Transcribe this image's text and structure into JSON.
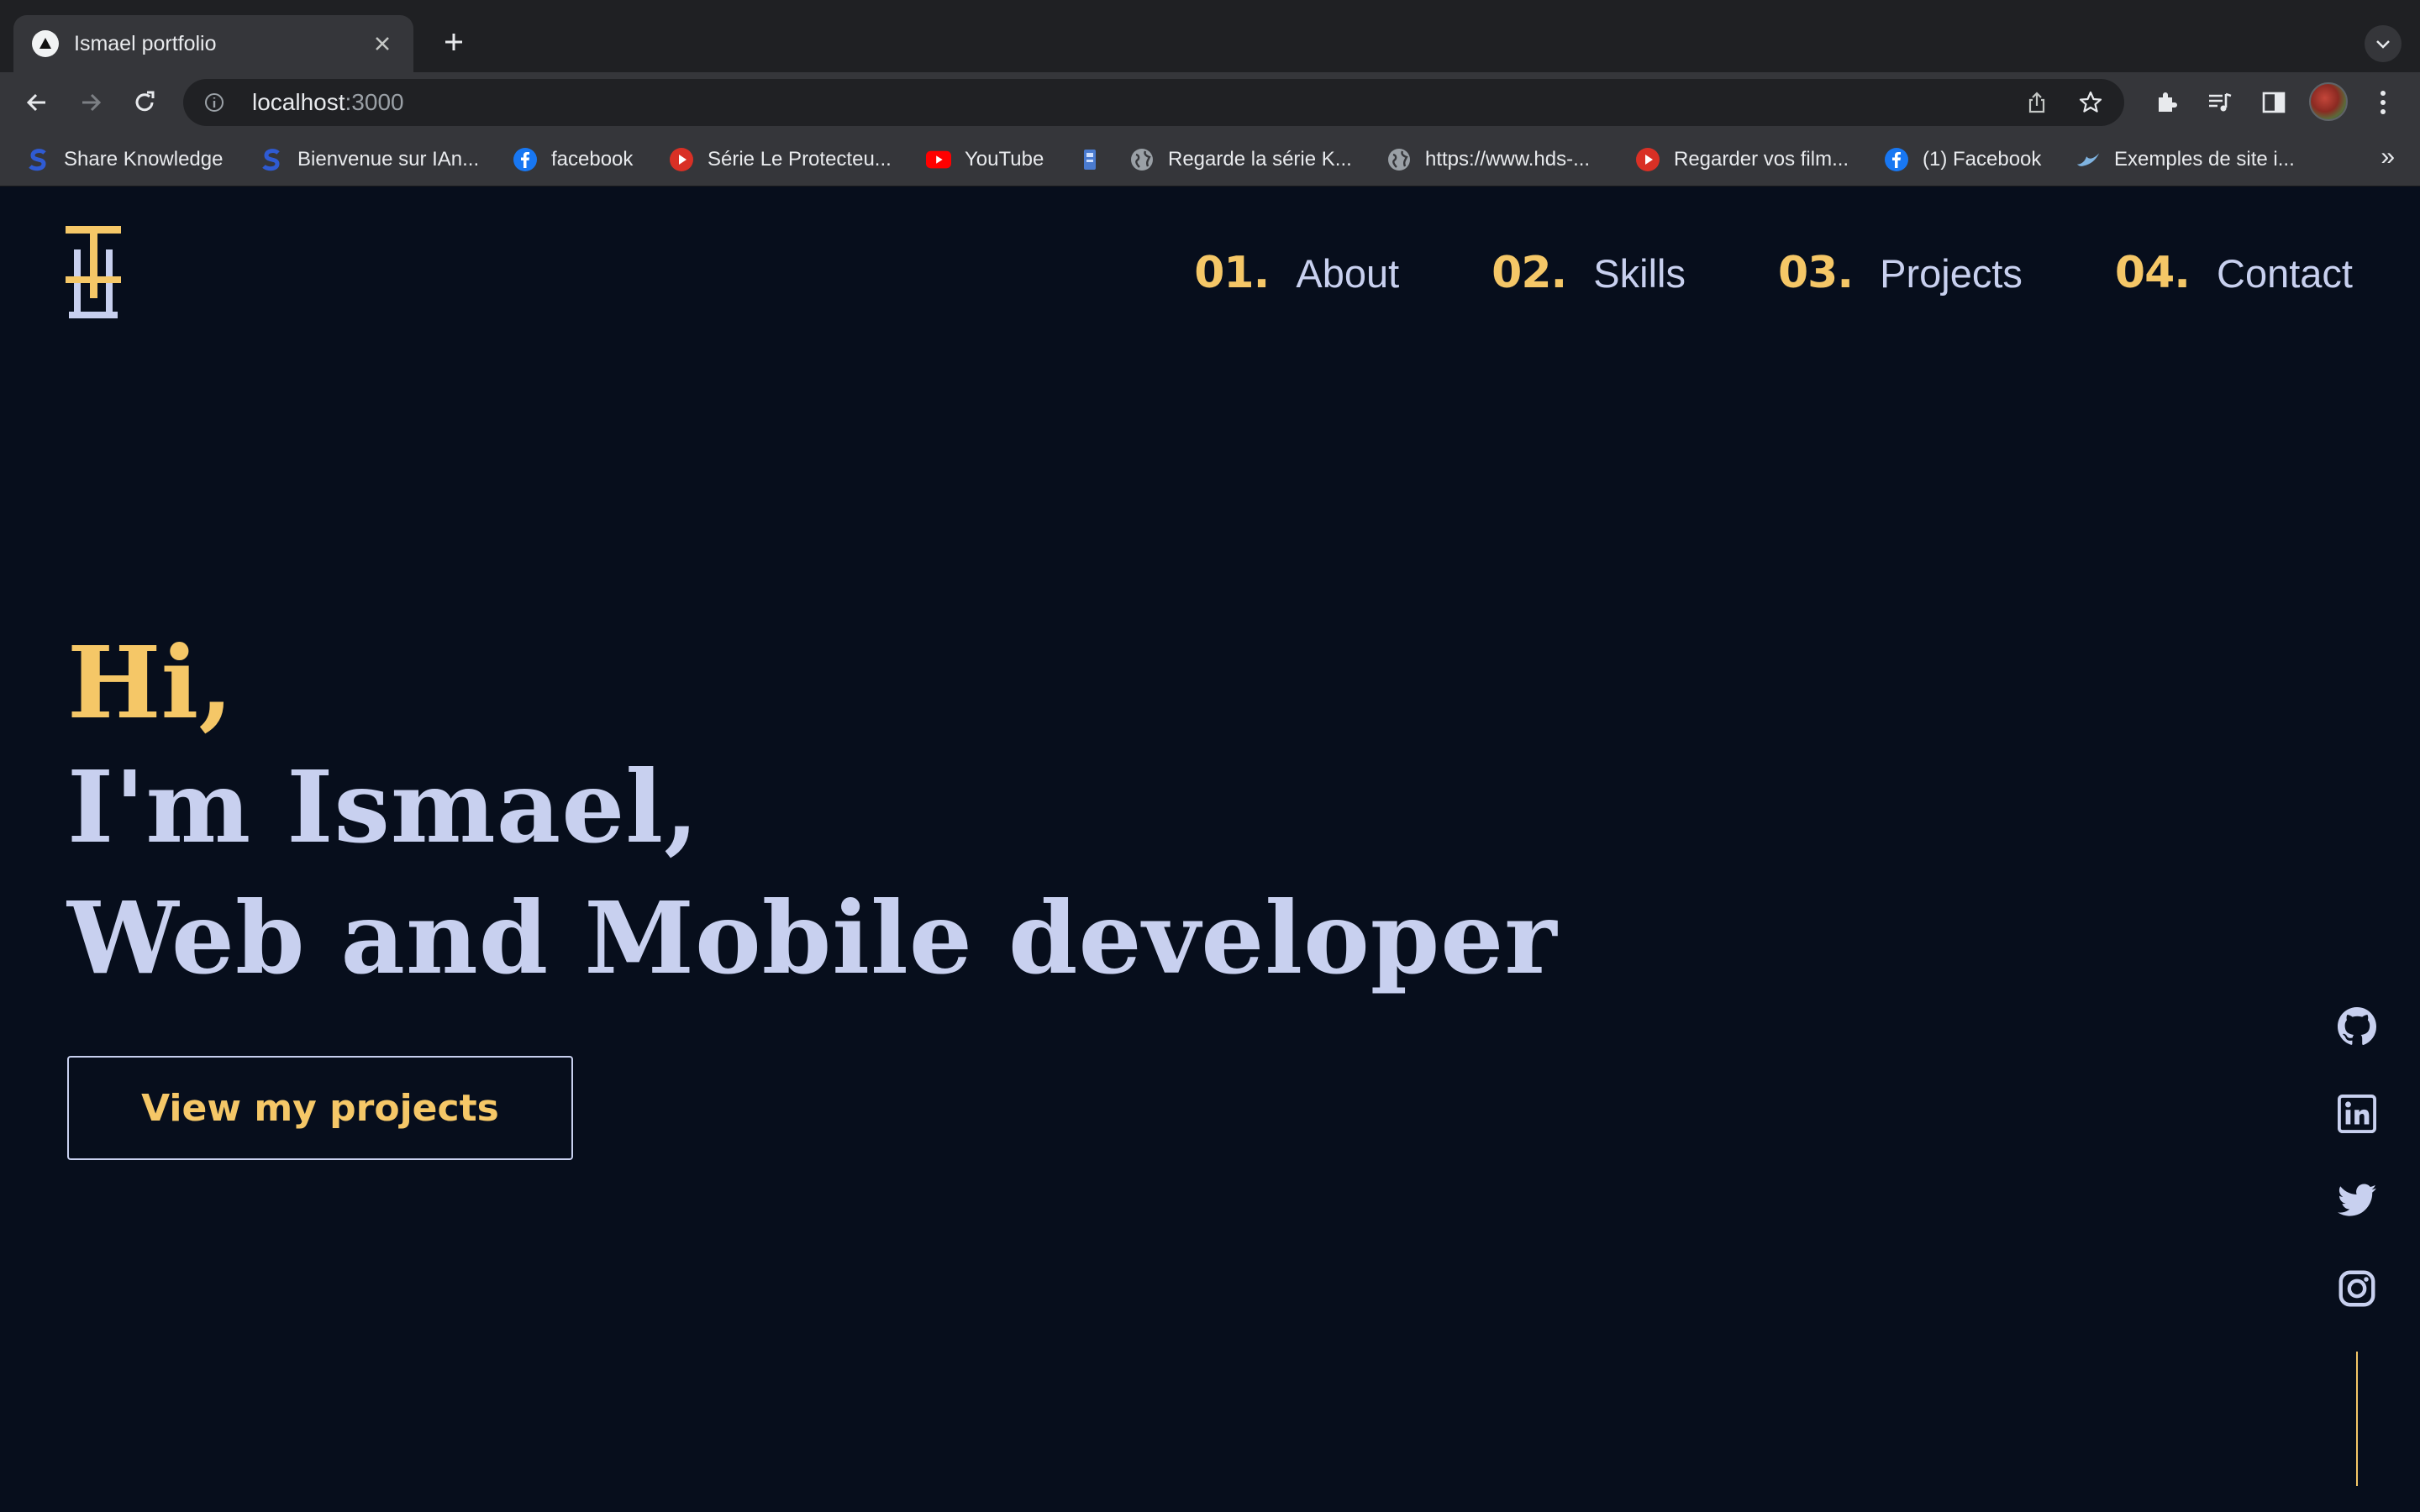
{
  "browser": {
    "tab_title": "Ismael portfolio",
    "url_host": "localhost",
    "url_port": ":3000",
    "bookmarks": [
      {
        "label": "Share Knowledge",
        "icon": "s-logo-icon"
      },
      {
        "label": "Bienvenue sur IAn...",
        "icon": "s-logo-icon"
      },
      {
        "label": "facebook",
        "icon": "facebook-icon"
      },
      {
        "label": "Série Le Protecteu...",
        "icon": "play-icon"
      },
      {
        "label": "YouTube",
        "icon": "youtube-icon"
      },
      {
        "label": "",
        "icon": "app-icon"
      },
      {
        "label": "Regarde la série K...",
        "icon": "globe-icon"
      },
      {
        "label": "https://www.hds-...",
        "icon": "globe-icon"
      },
      {
        "label": "Regarder vos film...",
        "icon": "play-icon"
      },
      {
        "label": "(1) Facebook",
        "icon": "facebook-icon"
      },
      {
        "label": "Exemples de site i...",
        "icon": "bird-icon"
      }
    ],
    "bookmarks_more": "»"
  },
  "site": {
    "nav": [
      {
        "num": "01.",
        "label": "About"
      },
      {
        "num": "02.",
        "label": "Skills"
      },
      {
        "num": "03.",
        "label": "Projects"
      },
      {
        "num": "04.",
        "label": "Contact"
      }
    ],
    "hero": {
      "greeting": "Hi,",
      "line1": "I'm Ismael,",
      "line2": "Web and Mobile developer"
    },
    "cta_label": "View my projects",
    "social": [
      "github-icon",
      "linkedin-icon",
      "twitter-icon",
      "instagram-icon"
    ]
  },
  "colors": {
    "background": "#070e1c",
    "accent": "#f5c767",
    "text": "#c8d0ef"
  }
}
